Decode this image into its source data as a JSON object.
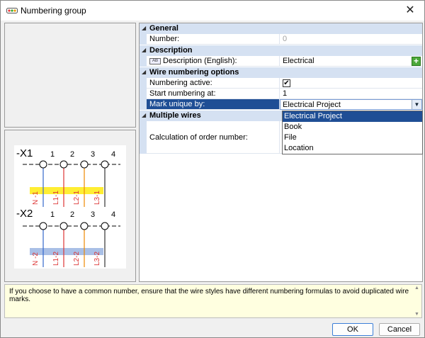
{
  "window": {
    "title": "Numbering group",
    "close_label": "✕"
  },
  "groups": {
    "general": {
      "label": "General",
      "number_label": "Number:",
      "number_value": "0"
    },
    "description": {
      "label": "Description",
      "desc_label": "Description (English):",
      "desc_value": "Electrical",
      "lang_icon": "AB"
    },
    "wire": {
      "label": "Wire numbering options",
      "active_label": "Numbering active:",
      "start_label": "Start numbering at:",
      "start_value": "1",
      "mark_label": "Mark unique by:",
      "mark_value": "Electrical Project"
    },
    "multiple": {
      "label": "Multiple wires",
      "calc_label": "Calculation of order number:"
    }
  },
  "dropdown": {
    "options": [
      "Electrical Project",
      "Book",
      "File",
      "Location"
    ]
  },
  "diagram": {
    "x1": "-X1",
    "x2": "-X2",
    "terms": [
      "1",
      "2",
      "3",
      "4"
    ],
    "top_wires": [
      "N -1",
      "L1-1",
      "L2-1",
      "L3-1"
    ],
    "bottom_wires": [
      "N -2",
      "L1-2",
      "L2-2",
      "L3-2"
    ],
    "colors": {
      "blue": "#3366cc",
      "red": "#dd3333",
      "orange": "#ee8800",
      "yellow": "#ffee33",
      "lightblue": "#a9bfe6"
    }
  },
  "help": {
    "text": "If you choose to have a common number, ensure that the wire styles have different numbering formulas to avoid duplicated wire marks."
  },
  "buttons": {
    "ok": "OK",
    "cancel": "Cancel"
  }
}
